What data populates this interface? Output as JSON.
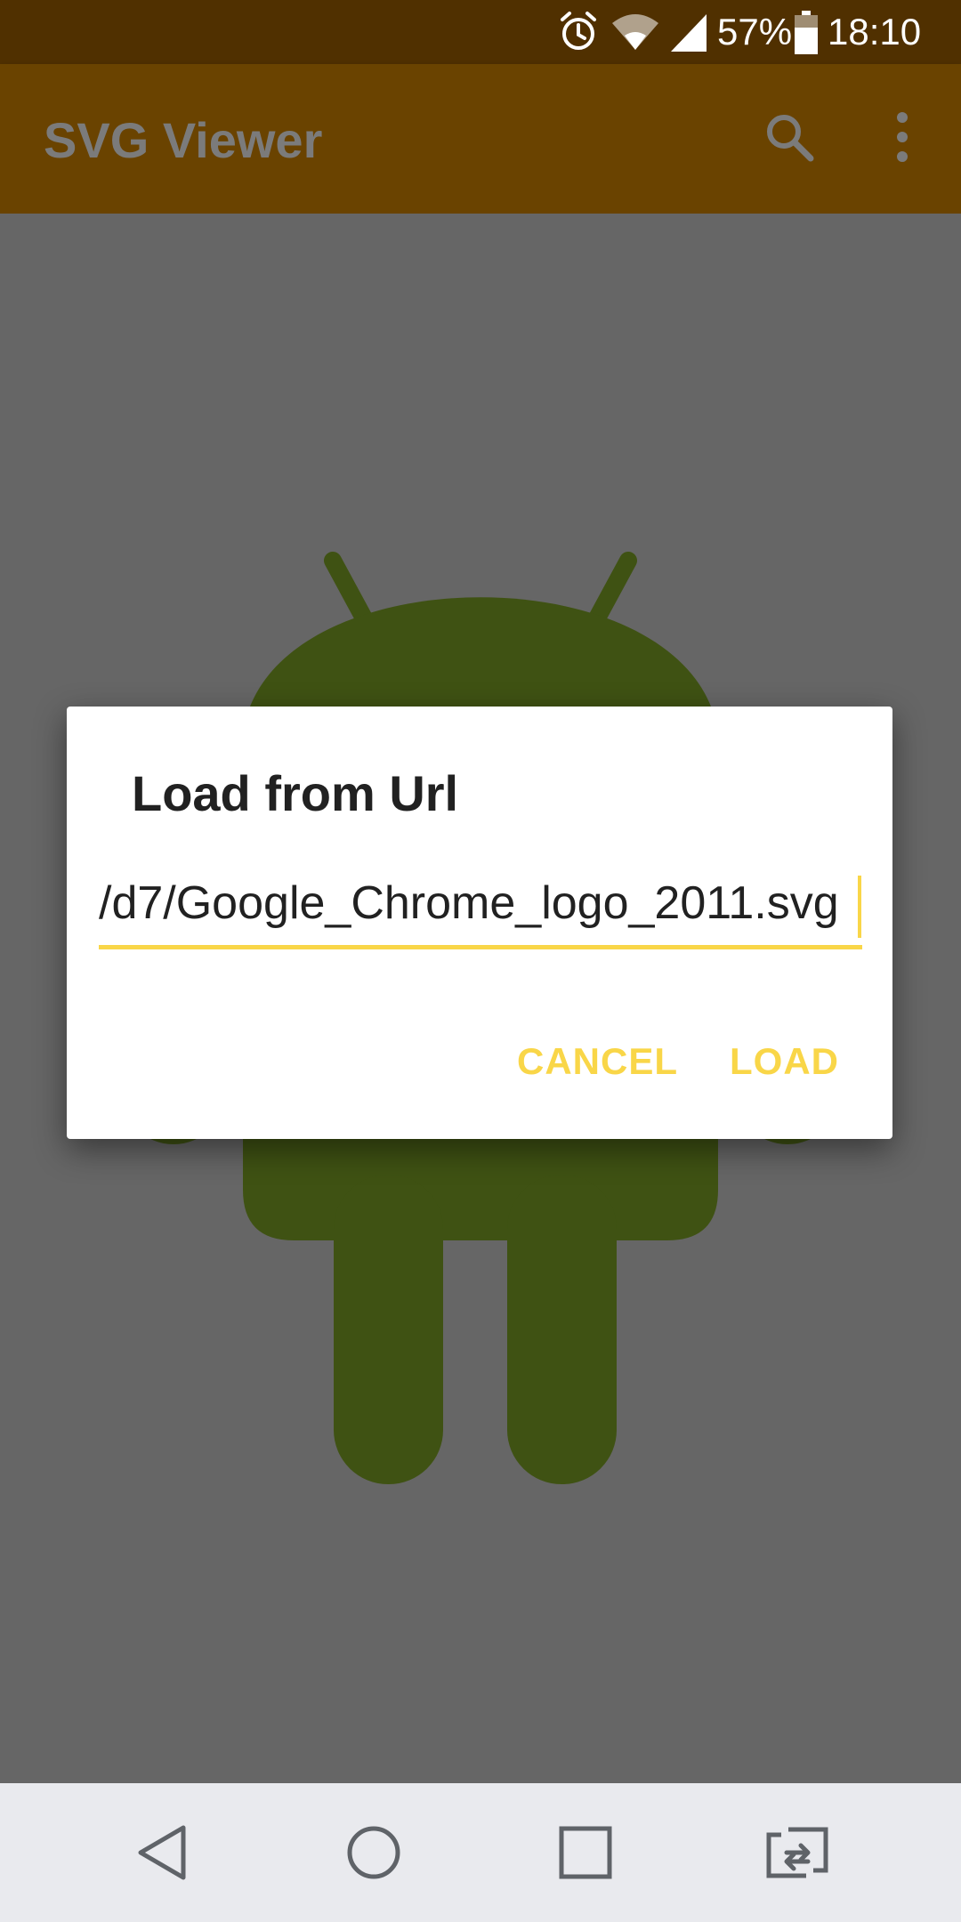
{
  "status_bar": {
    "battery_percent": "57%",
    "time": "18:10",
    "icons": [
      "alarm-icon",
      "wifi-icon",
      "signal-icon",
      "battery-icon"
    ]
  },
  "app_bar": {
    "title": "SVG Viewer",
    "actions": [
      "search-icon",
      "more-vert-icon"
    ]
  },
  "dialog": {
    "title": "Load from Url",
    "url_value": "/d7/Google_Chrome_logo_2011.svg",
    "cancel_label": "CANCEL",
    "load_label": "LOAD"
  },
  "nav_bar": {
    "buttons": [
      "back-icon",
      "home-icon",
      "recents-icon",
      "switch-app-icon"
    ]
  },
  "colors": {
    "status_bar": "#503000",
    "app_bar_dimmed": "#6a4300",
    "scrim_background": "#666666",
    "android_dimmed": "#3f5213",
    "accent": "#f9d648",
    "nav_bar": "#e9eaee"
  }
}
